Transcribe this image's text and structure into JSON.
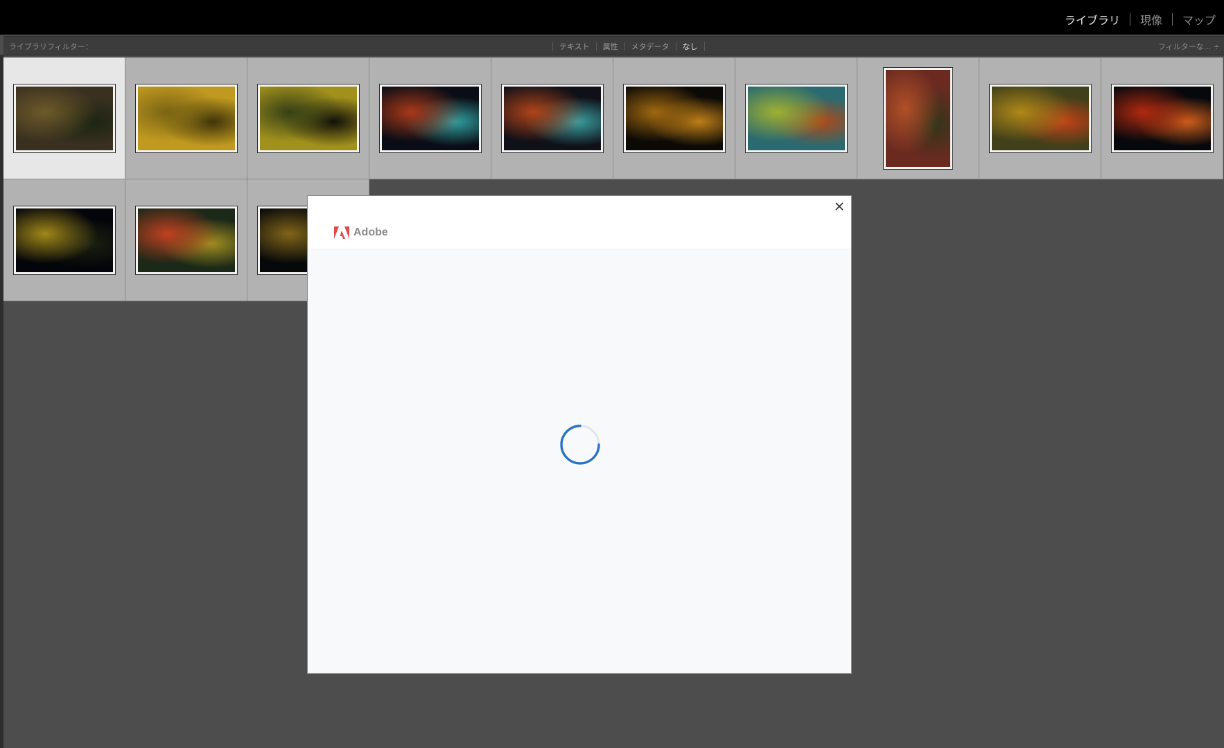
{
  "top_nav": {
    "modules": [
      "ライブラリ",
      "現像",
      "マップ"
    ],
    "active_module": "ライブラリ"
  },
  "filter_bar": {
    "label": "ライブラリフィルター：",
    "tabs": [
      "テキスト",
      "属性",
      "メタデータ",
      "なし"
    ],
    "active_tab": "なし",
    "preset": "フィルターな... ÷"
  },
  "grid": {
    "thumbnails": [
      {
        "orientation": "landscape",
        "colors": [
          "#3a3020",
          "#6d5a2a",
          "#1a2412"
        ],
        "selected": true
      },
      {
        "orientation": "landscape",
        "colors": [
          "#c09a20",
          "#7a6414",
          "#3a3008"
        ],
        "selected": false
      },
      {
        "orientation": "landscape",
        "colors": [
          "#a0901c",
          "#354016",
          "#0c0c08"
        ],
        "selected": false
      },
      {
        "orientation": "landscape",
        "colors": [
          "#0a0d16",
          "#a83818",
          "#30a0a0"
        ],
        "selected": false
      },
      {
        "orientation": "landscape",
        "colors": [
          "#101018",
          "#b04418",
          "#3aa0a0"
        ],
        "selected": false
      },
      {
        "orientation": "landscape",
        "colors": [
          "#0c0a06",
          "#a06810",
          "#c08018"
        ],
        "selected": false
      },
      {
        "orientation": "landscape",
        "colors": [
          "#2a6a70",
          "#a0b030",
          "#b04818"
        ],
        "selected": false
      },
      {
        "orientation": "portrait",
        "colors": [
          "#6a2a20",
          "#b05028",
          "#30361a"
        ],
        "selected": false
      },
      {
        "orientation": "landscape",
        "colors": [
          "#40401a",
          "#b08818",
          "#c04018"
        ],
        "selected": false
      },
      {
        "orientation": "landscape",
        "colors": [
          "#06080c",
          "#b02a10",
          "#d0601c"
        ],
        "selected": false
      },
      {
        "orientation": "landscape",
        "colors": [
          "#04050a",
          "#a08818",
          "#1a2010"
        ],
        "selected": false
      },
      {
        "orientation": "landscape",
        "colors": [
          "#1c2818",
          "#c04020",
          "#a09020"
        ],
        "selected": false
      },
      {
        "orientation": "landscape",
        "colors": [
          "#06080a",
          "#806418",
          "#1a2010"
        ],
        "selected": false
      }
    ]
  },
  "dialog": {
    "brand": "Adobe",
    "state": "loading"
  },
  "colors": {
    "spinner": "#2b73c4",
    "adobe_red": "#e04a4a"
  }
}
